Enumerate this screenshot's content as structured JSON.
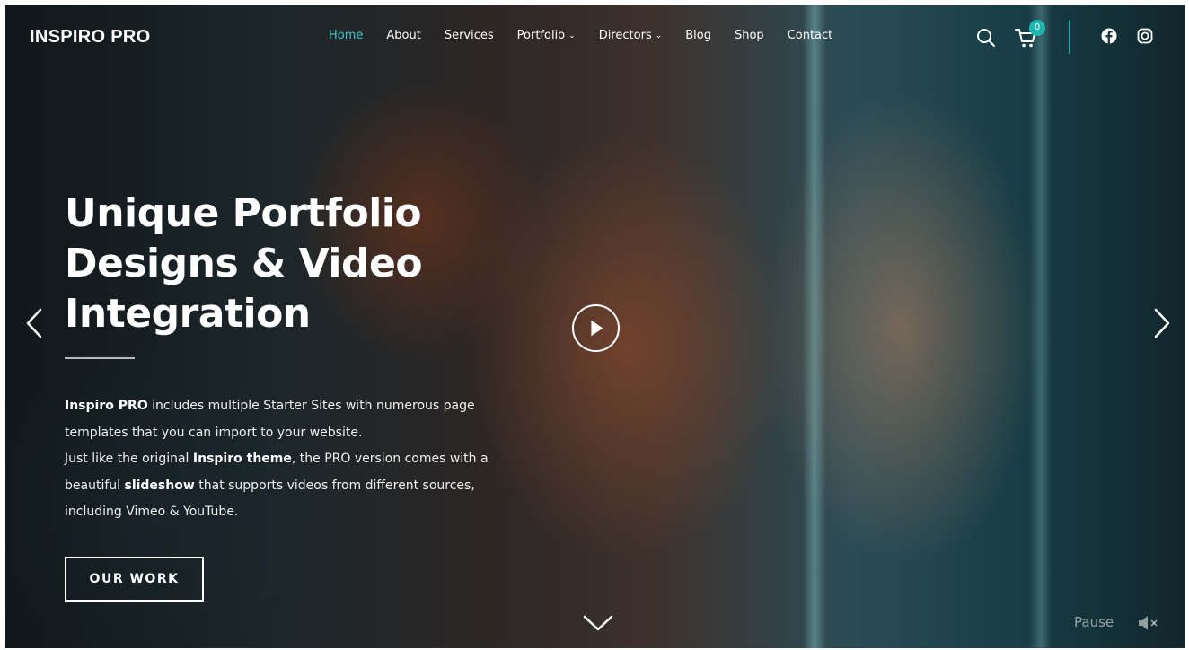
{
  "header": {
    "logo": "INSPIRO PRO",
    "nav": [
      {
        "label": "Home",
        "active": true,
        "dropdown": false
      },
      {
        "label": "About",
        "active": false,
        "dropdown": false
      },
      {
        "label": "Services",
        "active": false,
        "dropdown": false
      },
      {
        "label": "Portfolio",
        "active": false,
        "dropdown": true
      },
      {
        "label": "Directors",
        "active": false,
        "dropdown": true
      },
      {
        "label": "Blog",
        "active": false,
        "dropdown": false
      },
      {
        "label": "Shop",
        "active": false,
        "dropdown": false
      },
      {
        "label": "Contact",
        "active": false,
        "dropdown": false
      }
    ],
    "cart_count": "0",
    "icons": [
      "search-icon",
      "cart-icon",
      "facebook-icon",
      "instagram-icon"
    ]
  },
  "hero": {
    "headline": [
      "Unique Portfolio",
      "Designs & Video",
      "Integration"
    ],
    "description": [
      [
        {
          "text": "Inspiro PRO",
          "bold": true
        },
        {
          "text": " includes multiple Starter Sites with numerous page",
          "bold": false
        }
      ],
      [
        {
          "text": "templates that you can import to your website.",
          "bold": false
        }
      ],
      [
        {
          "text": "Just like the original ",
          "bold": false
        },
        {
          "text": "Inspiro theme",
          "bold": true
        },
        {
          "text": ", the PRO version comes with a",
          "bold": false
        }
      ],
      [
        {
          "text": "beautiful ",
          "bold": false
        },
        {
          "text": "slideshow",
          "bold": true
        },
        {
          "text": " that supports videos from different sources,",
          "bold": false
        }
      ],
      [
        {
          "text": "including Vimeo & YouTube.",
          "bold": false
        }
      ]
    ],
    "cta_label": "OUR WORK"
  },
  "controls": {
    "pause_label": "Pause"
  },
  "colors": {
    "accent": "#3fc6c4",
    "badge": "#1fb5b0",
    "text": "#ffffff"
  }
}
